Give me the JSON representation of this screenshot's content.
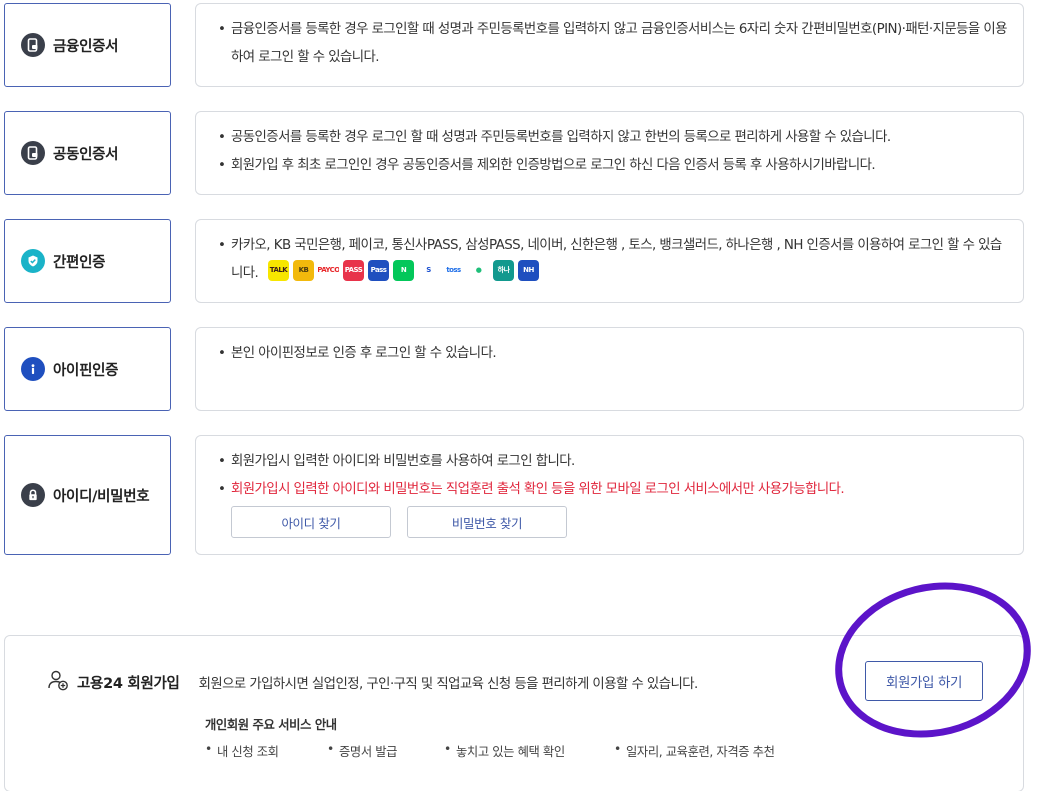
{
  "methods": [
    {
      "label": "금융인증서",
      "icon": "financial-certificate-icon",
      "lines": [
        "금융인증서를 등록한 경우 로그인할 때 성명과 주민등록번호를 입력하지 않고 금융인증서비스는 6자리 숫자 간편비밀번호(PIN)·패턴·지문등을 이용하여 로그인 할 수 있습니다."
      ]
    },
    {
      "label": "공동인증서",
      "icon": "joint-certificate-icon",
      "lines": [
        "공동인증서를 등록한 경우 로그인 할 때 성명과 주민등록번호를 입력하지 않고 한번의 등록으로 편리하게 사용할 수 있습니다.",
        "회원가입 후 최초 로그인인 경우 공동인증서를 제외한 인증방법으로 로그인 하신 다음 인증서 등록 후 사용하시기바랍니다."
      ]
    },
    {
      "label": "간편인증",
      "icon": "check-shield-icon",
      "line": "카카오, KB 국민은행, 페이코, 통신사PASS, 삼성PASS, 네이버, 신한은행 , 토스, 뱅크샐러드, 하나은행 , NH 인증서를 이용하여 로그인 할 수 있습니다.",
      "logos": [
        {
          "name": "kakao",
          "text": "TALK",
          "bg": "#f7e600",
          "fg": "#3a1d1d"
        },
        {
          "name": "kb",
          "text": "KB",
          "bg": "#f2b90c",
          "fg": "#4a3b10"
        },
        {
          "name": "payco",
          "text": "PAYCO",
          "bg": "#ffffff",
          "fg": "#e8272a"
        },
        {
          "name": "pass-telecom",
          "text": "PASS",
          "bg": "#e8334a",
          "fg": "#ffffff"
        },
        {
          "name": "samsung-pass",
          "text": "Pass",
          "bg": "#1f4fbf",
          "fg": "#ffffff"
        },
        {
          "name": "naver",
          "text": "N",
          "bg": "#03c75a",
          "fg": "#ffffff"
        },
        {
          "name": "shinhan",
          "text": "S",
          "bg": "#ffffff",
          "fg": "#1a4fd0"
        },
        {
          "name": "toss",
          "text": "toss",
          "bg": "#ffffff",
          "fg": "#1f6fe8"
        },
        {
          "name": "banksalad",
          "text": "●",
          "bg": "#ffffff",
          "fg": "#1fbf7a"
        },
        {
          "name": "hana",
          "text": "하나",
          "bg": "#12998e",
          "fg": "#ffffff"
        },
        {
          "name": "nh",
          "text": "NH",
          "bg": "#1f4fbf",
          "fg": "#ffffff"
        }
      ]
    },
    {
      "label": "아이핀인증",
      "icon": "info-icon",
      "lines": [
        "본인 아이핀정보로 인증 후 로그인 할 수 있습니다."
      ]
    },
    {
      "label": "아이디/비밀번호",
      "icon": "lock-icon",
      "lines": [
        "회원가입시 입력한 아이디와 비밀번호를 사용하여 로그인 합니다."
      ],
      "warning": "회원가입시 입력한 아이디와 비밀번호는 직업훈련 출석 확인 등을 위한 모바일 로그인 서비스에서만 사용가능합니다.",
      "find_id_label": "아이디 찾기",
      "find_pw_label": "비밀번호 찾기"
    }
  ],
  "join": {
    "title": "고용24 회원가입",
    "text": "회원으로 가입하시면 실업인정, 구인·구직 및 직업교육 신청 등을 편리하게 이용할 수 있습니다.",
    "button_label": "회원가입 하기",
    "services_title": "개인회원 주요 서비스 안내",
    "services": [
      "내 신청 조회",
      "증명서 발급",
      "놓치고 있는 혜택 확인",
      "일자리, 교육훈련, 자격증 추천"
    ],
    "icon": "user-add-icon"
  },
  "colors": {
    "accent": "#3f59a8",
    "border": "#4a63b4",
    "warning": "#e0263c",
    "highlight_circle": "#5c14c9",
    "check_icon": "#1ab3c8",
    "dark_icon": "#3a3f4a",
    "info_icon": "#1f4fbf"
  }
}
